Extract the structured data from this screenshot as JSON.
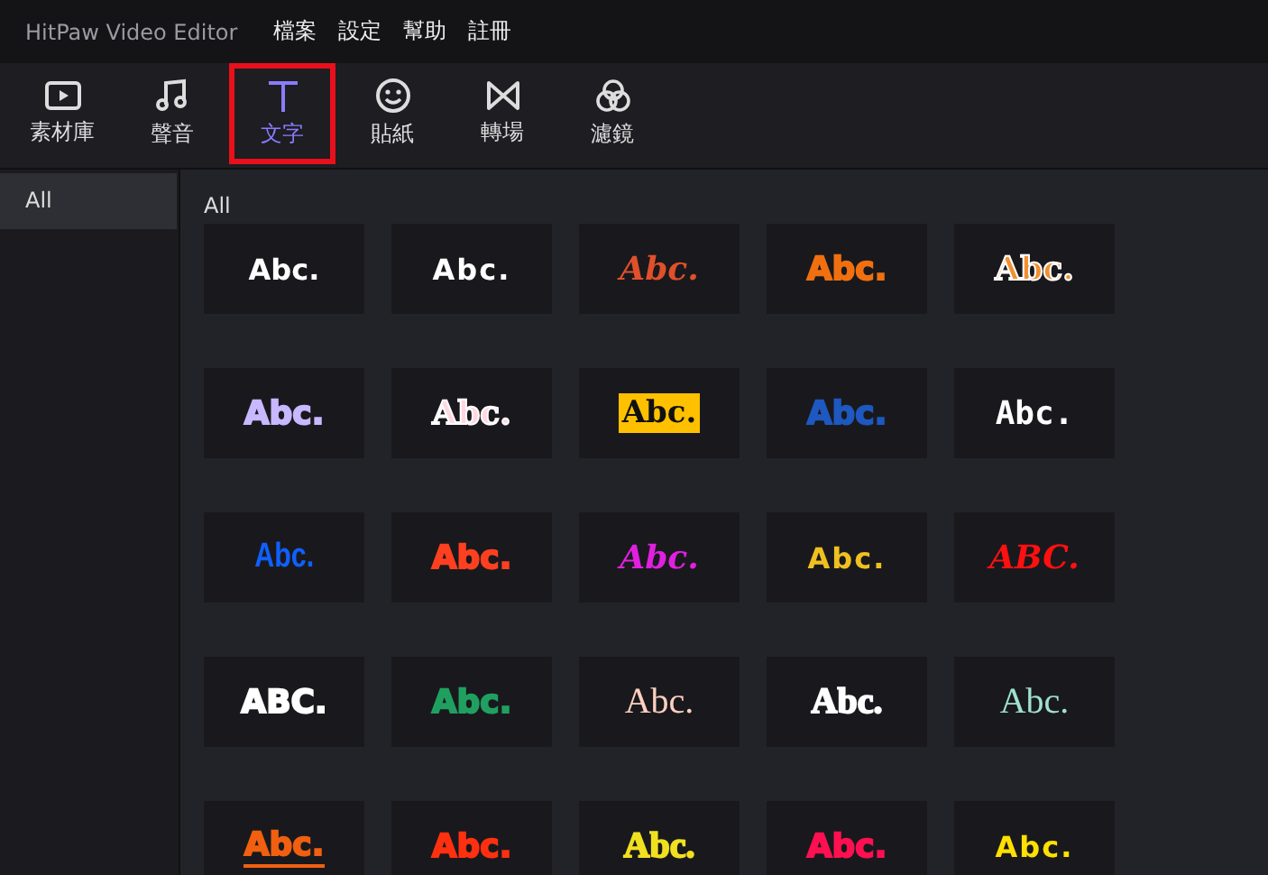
{
  "window": {
    "title": "HitPaw Video Editor"
  },
  "menu": [
    "檔案",
    "設定",
    "幫助",
    "註冊"
  ],
  "tabs": [
    {
      "label": "素材庫",
      "kind": "media",
      "selected": false
    },
    {
      "label": "聲音",
      "kind": "music",
      "selected": false
    },
    {
      "label": "文字",
      "kind": "text",
      "selected": true
    },
    {
      "label": "貼紙",
      "kind": "sticker",
      "selected": false
    },
    {
      "label": "轉場",
      "kind": "transition",
      "selected": false
    },
    {
      "label": "濾鏡",
      "kind": "filter",
      "selected": false
    }
  ],
  "sidebar": {
    "items": [
      {
        "label": "All",
        "selected": true
      }
    ]
  },
  "content": {
    "heading": "All",
    "presets": [
      {
        "text": "Abc.",
        "color": "#ffffff",
        "kind": "sans"
      },
      {
        "text": "Abc.",
        "color": "#ffffff",
        "kind": "wide"
      },
      {
        "text": "Abc.",
        "color": "#e0502a",
        "kind": "script"
      },
      {
        "text": "Abc.",
        "color": "#f07010",
        "kind": "heavy"
      },
      {
        "text": "Abc.",
        "color": "#f09030",
        "kind": "outlined"
      },
      {
        "text": "Abc.",
        "color": "#c8b8ff",
        "kind": "heavy"
      },
      {
        "text": "Abc.",
        "color": "#ffd8e0",
        "kind": "outlined"
      },
      {
        "text": "Abc.",
        "color": "#ffc000",
        "kind": "boxed"
      },
      {
        "text": "Abc.",
        "color": "#1e58c0",
        "kind": "heavy"
      },
      {
        "text": "Abc.",
        "color": "#ffffff",
        "kind": "pixel"
      },
      {
        "text": "Abc.",
        "color": "#1060ff",
        "kind": "condensed"
      },
      {
        "text": "Abc.",
        "color": "#ff4020",
        "kind": "heavy"
      },
      {
        "text": "Abc.",
        "color": "#e020e0",
        "kind": "script"
      },
      {
        "text": "Abc.",
        "color": "#f0c020",
        "kind": "wide"
      },
      {
        "text": "ABC.",
        "color": "#ff1010",
        "kind": "script"
      },
      {
        "text": "ABC.",
        "color": "#ffffff",
        "kind": "heavy"
      },
      {
        "text": "Abc.",
        "color": "#20a060",
        "kind": "heavy"
      },
      {
        "text": "Abc.",
        "color": "#ffd0c0",
        "kind": "serif"
      },
      {
        "text": "Abc.",
        "color": "#ffffff",
        "kind": "hollow"
      },
      {
        "text": "Abc.",
        "color": "#a0e0d0",
        "kind": "serif"
      },
      {
        "text": "Abc.",
        "color": "#f06010",
        "kind": "underlined"
      },
      {
        "text": "Abc.",
        "color": "#ff3010",
        "kind": "heavy"
      },
      {
        "text": "Abc.",
        "color": "#f0e020",
        "kind": "hollow"
      },
      {
        "text": "Abc.",
        "color": "#ff1050",
        "kind": "heavy"
      },
      {
        "text": "Abc.",
        "color": "#ffe000",
        "kind": "wide"
      }
    ]
  }
}
